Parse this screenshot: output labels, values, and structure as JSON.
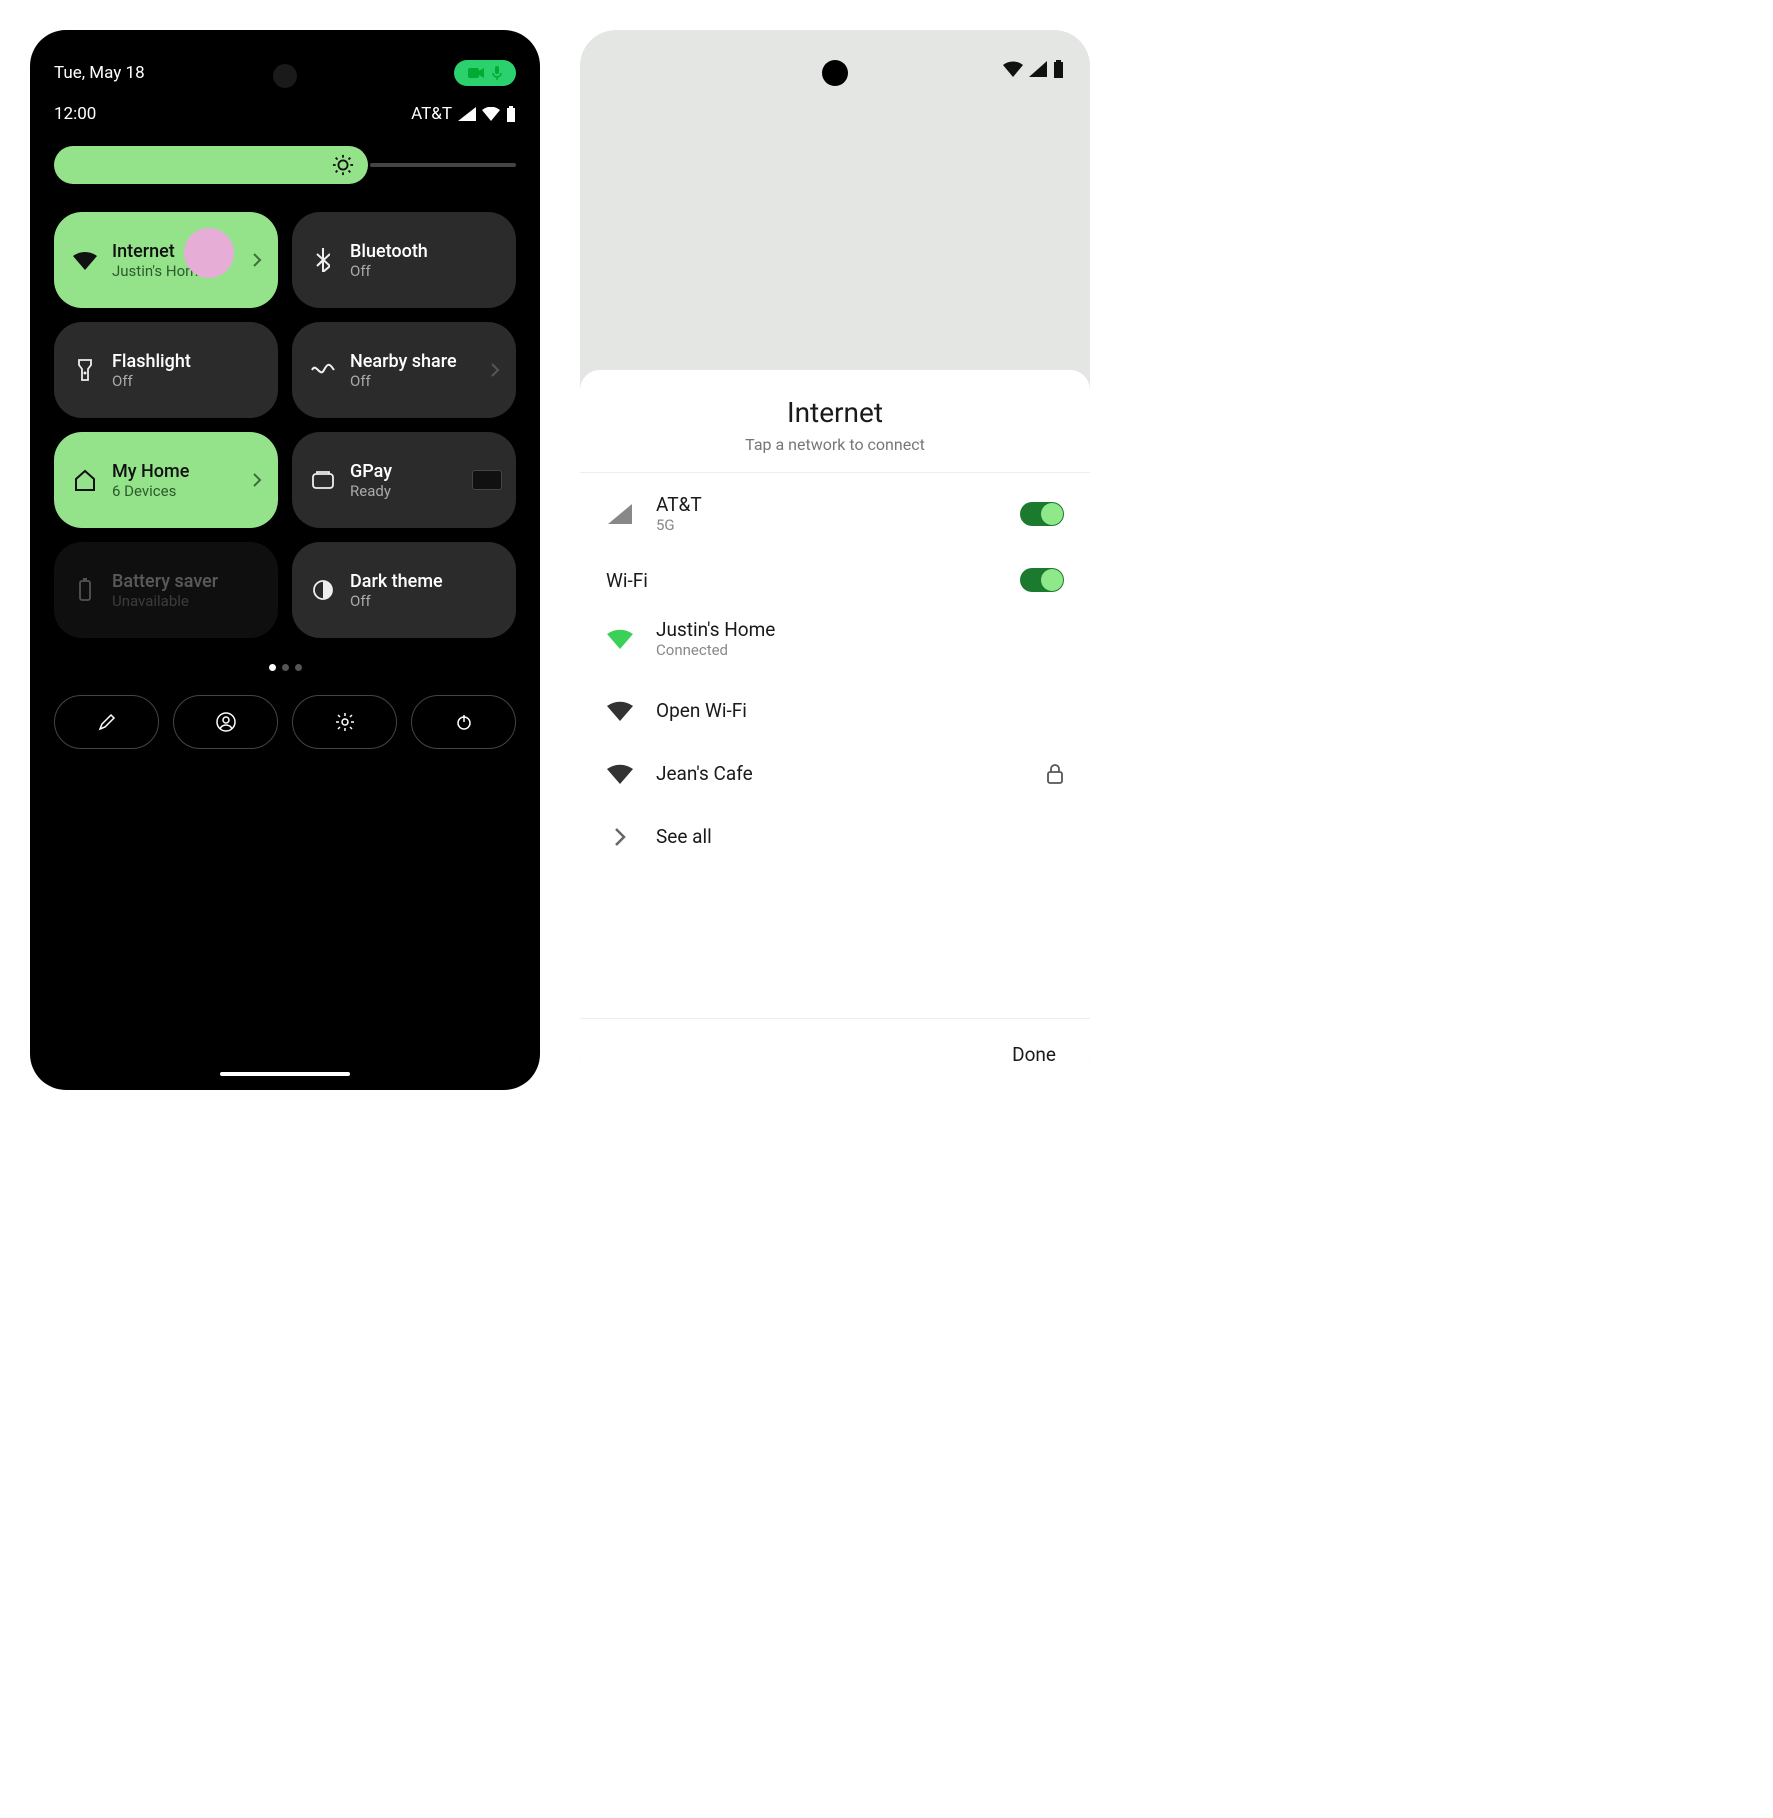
{
  "left": {
    "date": "Tue, May 18",
    "time": "12:00",
    "carrier": "AT&T",
    "tiles": [
      {
        "icon": "wifi",
        "title": "Internet",
        "sub": "Justin's Home",
        "active": true,
        "chevron": true
      },
      {
        "icon": "bluetooth",
        "title": "Bluetooth",
        "sub": "Off",
        "active": false,
        "chevron": false
      },
      {
        "icon": "flashlight",
        "title": "Flashlight",
        "sub": "Off",
        "active": false,
        "chevron": false
      },
      {
        "icon": "nearby",
        "title": "Nearby share",
        "sub": "Off",
        "active": false,
        "chevron": true
      },
      {
        "icon": "home",
        "title": "My Home",
        "sub": "6 Devices",
        "active": true,
        "chevron": true
      },
      {
        "icon": "wallet",
        "title": "GPay",
        "sub": "Ready",
        "active": false,
        "chevron": false,
        "card": true
      },
      {
        "icon": "battery",
        "title": "Battery saver",
        "sub": "Unavailable",
        "active": false,
        "chevron": false,
        "dim": true
      },
      {
        "icon": "contrast",
        "title": "Dark theme",
        "sub": "Off",
        "active": false,
        "chevron": false
      }
    ]
  },
  "right": {
    "title": "Internet",
    "subtitle": "Tap a network to connect",
    "mobile": {
      "name": "AT&T",
      "sub": "5G",
      "on": true
    },
    "wifi_label": "Wi-Fi",
    "wifi_on": true,
    "networks": [
      {
        "name": "Justin's Home",
        "sub": "Connected",
        "connected": true,
        "locked": false
      },
      {
        "name": "Open Wi-Fi",
        "sub": "",
        "connected": false,
        "locked": false
      },
      {
        "name": "Jean's Cafe",
        "sub": "",
        "connected": false,
        "locked": true
      }
    ],
    "see_all": "See all",
    "done": "Done"
  }
}
